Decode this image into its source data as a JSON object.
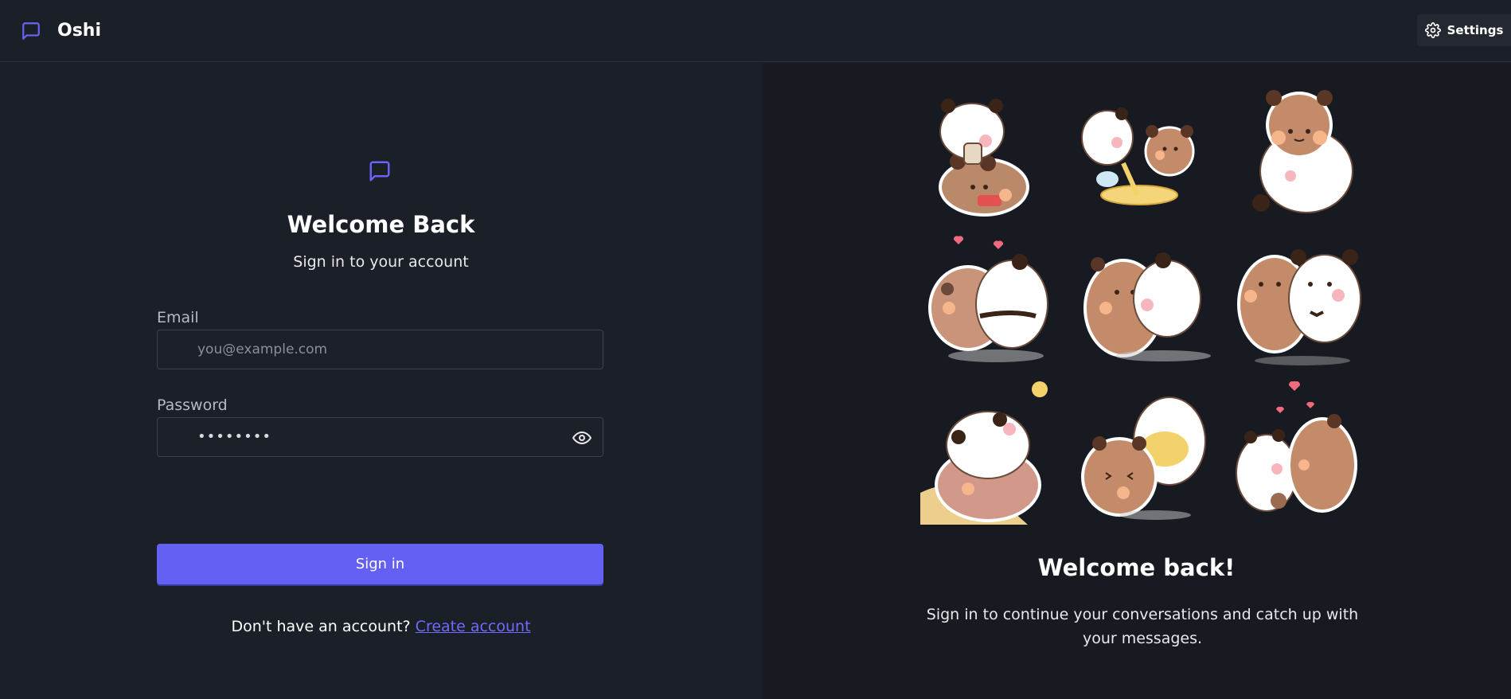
{
  "app": {
    "name": "Oshi",
    "settings_label": "Settings"
  },
  "form": {
    "title": "Welcome Back",
    "subtitle": "Sign in to your account",
    "email_label": "Email",
    "email_placeholder": "you@example.com",
    "email_value": "",
    "password_label": "Password",
    "password_value": "••••••••",
    "submit_label": "Sign in",
    "signup_prompt": "Don't have an account?",
    "signup_link": "Create account"
  },
  "promo": {
    "title": "Welcome back!",
    "text": "Sign in to continue your conversations and catch up with your messages."
  },
  "icons": {
    "brand": "message-square-icon",
    "settings": "gear-icon",
    "password_toggle": "eye-icon"
  },
  "colors": {
    "accent": "#6360f3",
    "link": "#6f6bff",
    "background": "#1b1f27",
    "panel": "#171a21"
  },
  "stickers": [
    "panda-bear-drinking-bubble-tea",
    "panda-and-bear-painting",
    "bear-hugging-panda",
    "bear-and-panda-hearts",
    "bear-and-panda-cuddling",
    "bear-and-panda-walking",
    "panda-sleeping-on-bear",
    "bear-and-panda-laughing",
    "panda-and-bear-kissing-hearts"
  ]
}
